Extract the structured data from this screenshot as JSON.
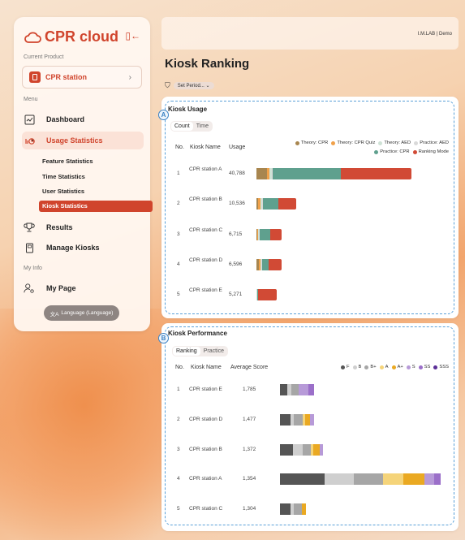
{
  "sidebar": {
    "logo": "CPR cloud",
    "current_product_label": "Current Product",
    "product": "CPR station",
    "menu_label": "Menu",
    "menu": [
      {
        "label": "Dashboard"
      },
      {
        "label": "Usage Statistics"
      },
      {
        "label": "Results"
      },
      {
        "label": "Manage Kiosks"
      }
    ],
    "sub_items": [
      "Feature Statistics",
      "Time Statistics",
      "User Statistics",
      "Kiosk Statistics"
    ],
    "my_info_label": "My Info",
    "my_page": "My Page",
    "language": "Language (Language)"
  },
  "header": {
    "user": "I.M.LAB | Demo",
    "title": "Kiosk Ranking",
    "period": "Set Period..."
  },
  "usage": {
    "badge": "A",
    "title": "Kiosk Usage",
    "tabs": [
      "Count",
      "Time"
    ],
    "columns": [
      "No.",
      "Kiosk Name",
      "Usage"
    ],
    "legend": [
      {
        "label": "Theory: CPR",
        "color": "#a8864f"
      },
      {
        "label": "Theory: CPR Quiz",
        "color": "#f0a14a"
      },
      {
        "label": "Theory: AED",
        "color": "#cfe2d6"
      },
      {
        "label": "Practice: AED",
        "color": "#d9d9d9"
      },
      {
        "label": "Practice: CPR",
        "color": "#5fa08e"
      },
      {
        "label": "Ranking Mode",
        "color": "#d14a35"
      }
    ],
    "rows": [
      {
        "no": "1",
        "name": "CPR station A",
        "usage": "40,788",
        "total": 40788,
        "mix": [
          0.07,
          0.015,
          0.015,
          0.005,
          0.44,
          0.455
        ]
      },
      {
        "no": "2",
        "name": "CPR station B",
        "usage": "10,536",
        "total": 10536,
        "mix": [
          0.05,
          0.05,
          0.05,
          0.02,
          0.38,
          0.45
        ]
      },
      {
        "no": "3",
        "name": "CPR station C",
        "usage": "6,715",
        "total": 6715,
        "mix": [
          0.04,
          0.02,
          0.04,
          0.02,
          0.42,
          0.46
        ]
      },
      {
        "no": "4",
        "name": "CPR station D",
        "usage": "6,596",
        "total": 6596,
        "mix": [
          0.1,
          0.06,
          0.04,
          0.02,
          0.28,
          0.5
        ]
      },
      {
        "no": "5",
        "name": "CPR station E",
        "usage": "5,271",
        "total": 5271,
        "mix": [
          0.0,
          0.0,
          0.04,
          0.02,
          0.04,
          0.9
        ]
      }
    ]
  },
  "performance": {
    "badge": "B",
    "title": "Kiosk Performance",
    "tabs": [
      "Ranking",
      "Practice"
    ],
    "columns": [
      "No.",
      "Kiosk Name",
      "Average Score"
    ],
    "legend": [
      {
        "label": "F",
        "color": "#555555"
      },
      {
        "label": "B",
        "color": "#cfcfcf"
      },
      {
        "label": "B+",
        "color": "#a6a6a6"
      },
      {
        "label": "A",
        "color": "#f5d47a"
      },
      {
        "label": "A+",
        "color": "#eaa922"
      },
      {
        "label": "S",
        "color": "#b79ad8"
      },
      {
        "label": "SS",
        "color": "#9b6fc9"
      },
      {
        "label": "SSS",
        "color": "#5b2e97"
      }
    ],
    "rows": [
      {
        "no": "1",
        "name": "CPR station E",
        "score": "1,785",
        "total": 12,
        "mix": [
          0.22,
          0.1,
          0.22,
          0.0,
          0.0,
          0.28,
          0.18,
          0.0
        ]
      },
      {
        "no": "2",
        "name": "CPR station D",
        "score": "1,477",
        "total": 12,
        "mix": [
          0.3,
          0.1,
          0.25,
          0.08,
          0.15,
          0.12,
          0.0,
          0.0
        ]
      },
      {
        "no": "3",
        "name": "CPR station B",
        "score": "1,372",
        "total": 15,
        "mix": [
          0.3,
          0.22,
          0.2,
          0.05,
          0.15,
          0.08,
          0.0,
          0.0
        ]
      },
      {
        "no": "4",
        "name": "CPR station A",
        "score": "1,354",
        "total": 56,
        "mix": [
          0.28,
          0.18,
          0.18,
          0.13,
          0.13,
          0.06,
          0.04,
          0.0
        ]
      },
      {
        "no": "5",
        "name": "CPR station C",
        "score": "1,304",
        "total": 9,
        "mix": [
          0.4,
          0.15,
          0.3,
          0.0,
          0.15,
          0.0,
          0.0,
          0.0
        ]
      }
    ]
  }
}
